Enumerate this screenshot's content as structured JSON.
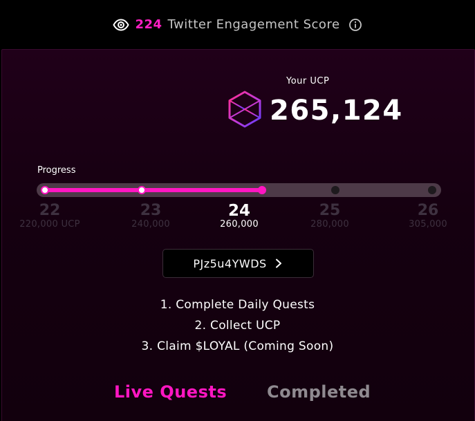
{
  "header": {
    "engagement_score": "224",
    "engagement_label": "Twitter Engagement Score",
    "eye_icon": "eye-icon",
    "info_icon": "info-icon"
  },
  "ucp": {
    "title": "Your UCP",
    "value": "265,124",
    "icon": "hexagon-cube-icon"
  },
  "progress": {
    "label": "Progress",
    "fill_fraction": 0.56,
    "levels": [
      {
        "level": "22",
        "requirement": "220,000 UCP",
        "state": "done"
      },
      {
        "level": "23",
        "requirement": "240,000",
        "state": "done"
      },
      {
        "level": "24",
        "requirement": "260,000",
        "state": "current"
      },
      {
        "level": "25",
        "requirement": "280,000",
        "state": "future"
      },
      {
        "level": "26",
        "requirement": "305,000",
        "state": "future"
      }
    ]
  },
  "referral": {
    "code": "PJz5u4YWDS",
    "chevron_icon": "chevron-right-icon"
  },
  "steps": [
    "1. Complete Daily Quests",
    "2. Collect UCP",
    "3. Claim $LOYAL (Coming Soon)"
  ],
  "tabs": {
    "live": "Live Quests",
    "completed": "Completed"
  },
  "colors": {
    "accent": "#ff16c2",
    "background": "#1a0014",
    "muted": "#3e3140"
  }
}
